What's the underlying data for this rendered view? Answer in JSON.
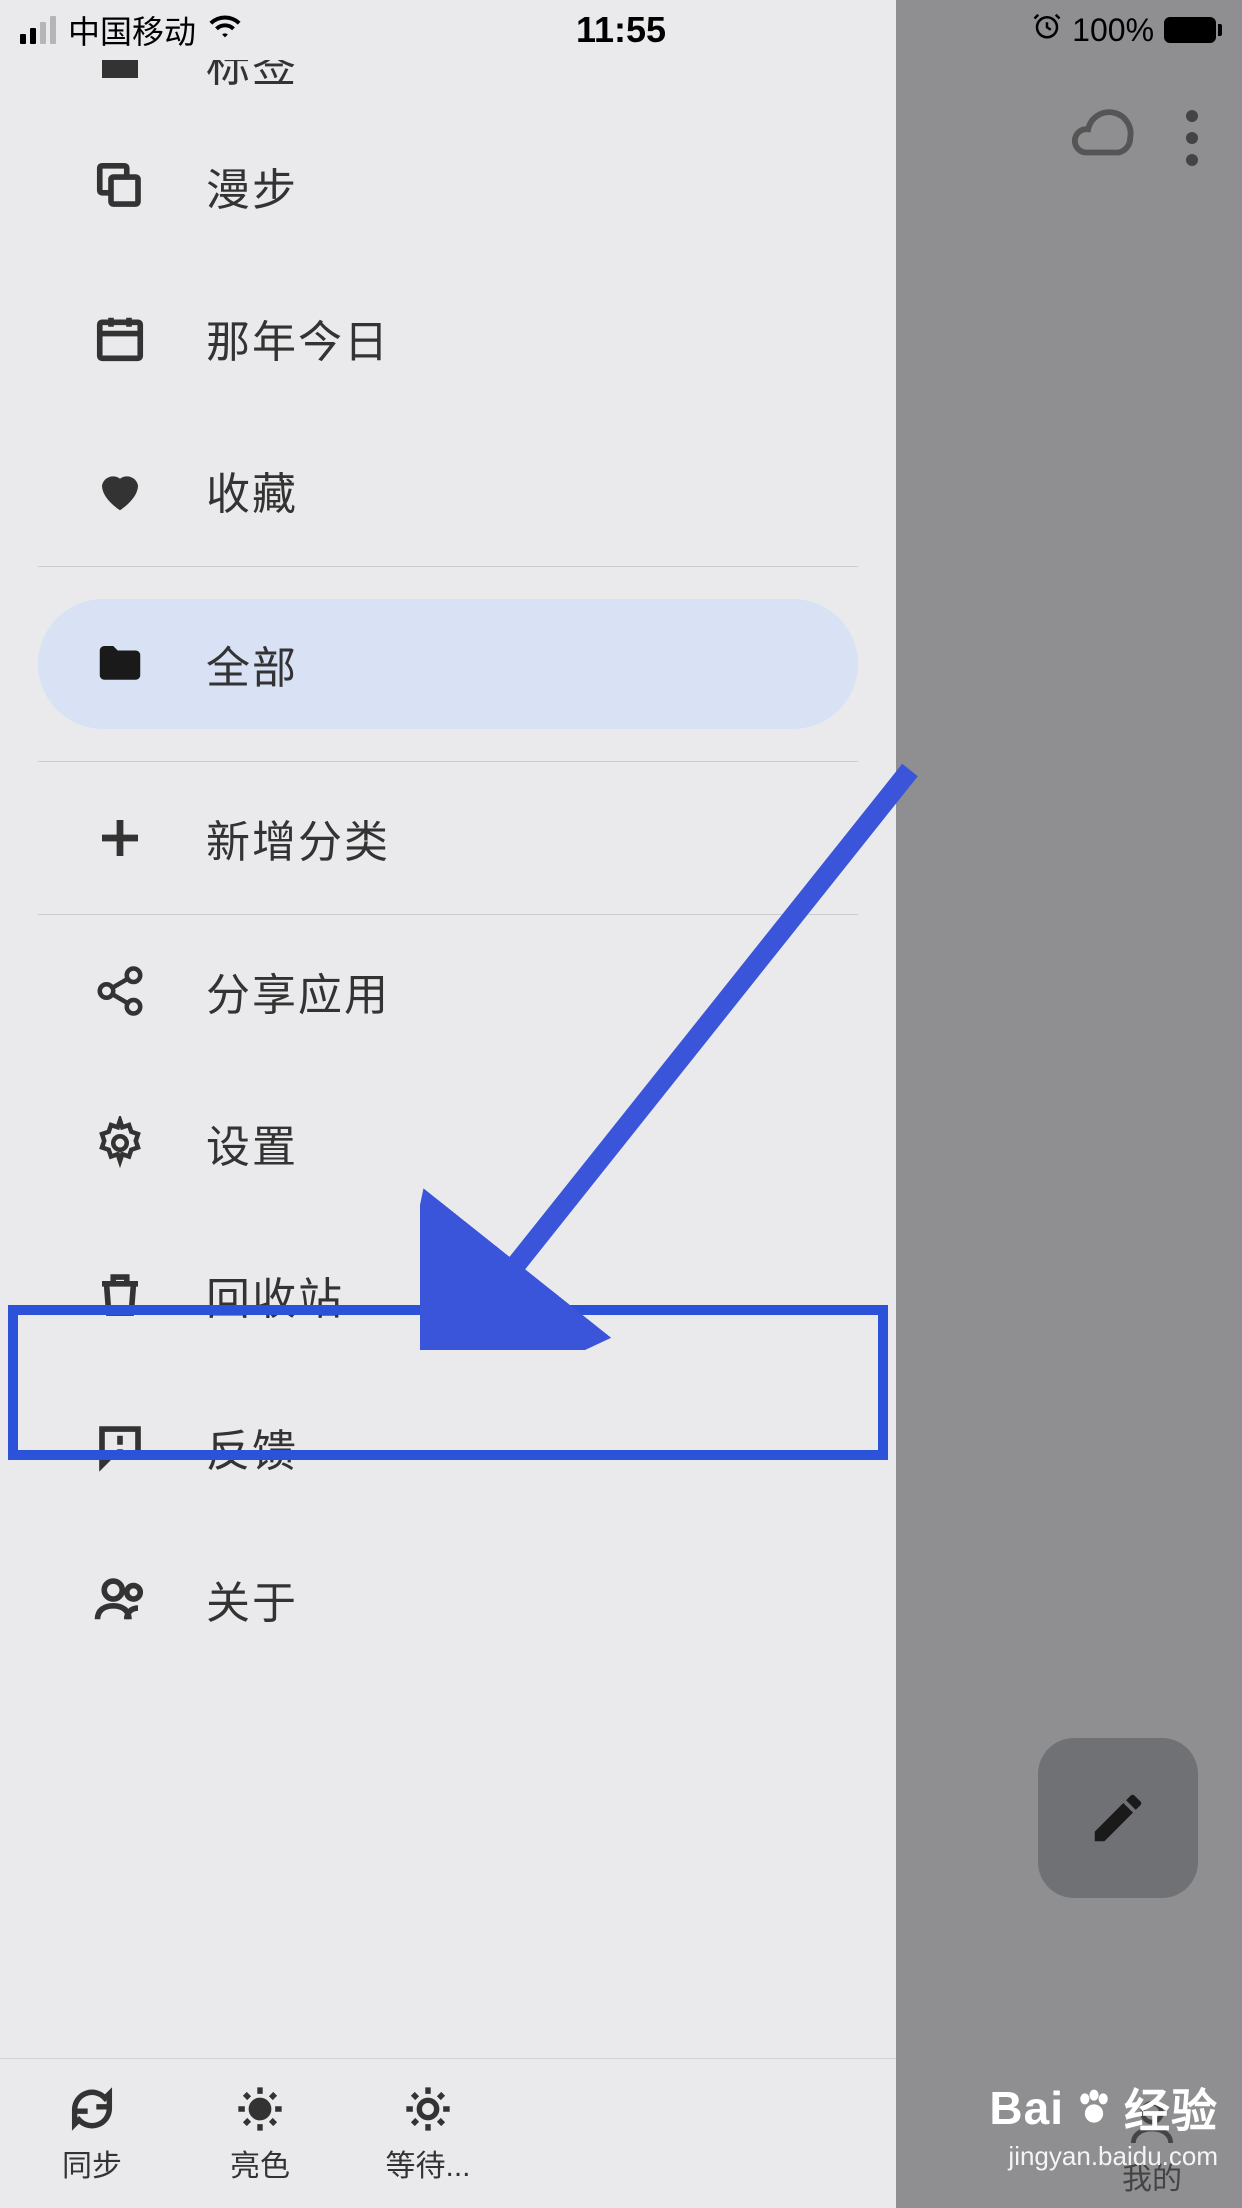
{
  "status": {
    "carrier": "中国移动",
    "time": "11:55",
    "battery": "100%"
  },
  "drawer": {
    "items_top": [
      {
        "icon": "tag",
        "label": "标签"
      },
      {
        "icon": "wander",
        "label": "漫步"
      },
      {
        "icon": "calendar",
        "label": "那年今日"
      },
      {
        "icon": "heart",
        "label": "收藏"
      }
    ],
    "folder": {
      "label": "全部"
    },
    "add_category": {
      "label": "新增分类"
    },
    "items_bottom": [
      {
        "icon": "share",
        "label": "分享应用"
      },
      {
        "icon": "gear",
        "label": "设置",
        "highlight": true
      },
      {
        "icon": "trash",
        "label": "回收站"
      },
      {
        "icon": "feedback",
        "label": "反馈"
      },
      {
        "icon": "about",
        "label": "关于"
      }
    ],
    "bottom_actions": [
      {
        "icon": "sync",
        "label": "同步"
      },
      {
        "icon": "light",
        "label": "亮色"
      },
      {
        "icon": "pending",
        "label": "等待..."
      }
    ]
  },
  "background": {
    "nav_my": "我的"
  },
  "watermark": {
    "brand": "Baidu",
    "suffix": "经验",
    "url": "jingyan.baidu.com"
  }
}
